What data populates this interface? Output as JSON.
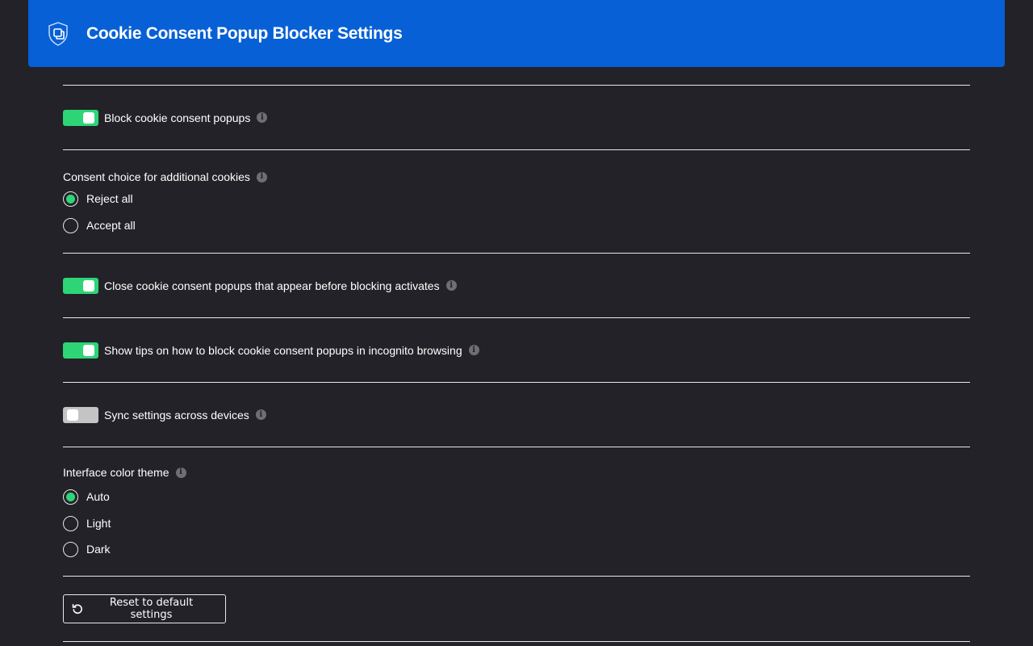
{
  "header": {
    "title": "Cookie Consent Popup Blocker Settings",
    "logo_icon": "shield-copy-icon",
    "background_color": "#0760d6"
  },
  "settings": {
    "block_popups": {
      "label": "Block cookie consent popups",
      "enabled": true,
      "info_icon": "info-icon"
    },
    "consent_choice": {
      "title": "Consent choice for additional cookies",
      "info_icon": "info-icon",
      "options": [
        {
          "label": "Reject all",
          "selected": true
        },
        {
          "label": "Accept all",
          "selected": false
        }
      ]
    },
    "close_early_popups": {
      "label": "Close cookie consent popups that appear before blocking activates",
      "enabled": true,
      "info_icon": "info-icon"
    },
    "incognito_tips": {
      "label": "Show tips on how to block cookie consent popups in incognito browsing",
      "enabled": true,
      "info_icon": "info-icon"
    },
    "sync_settings": {
      "label": "Sync settings across devices",
      "enabled": false,
      "info_icon": "info-icon"
    },
    "color_theme": {
      "title": "Interface color theme",
      "info_icon": "info-icon",
      "options": [
        {
          "label": "Auto",
          "selected": true
        },
        {
          "label": "Light",
          "selected": false
        },
        {
          "label": "Dark",
          "selected": false
        }
      ]
    }
  },
  "reset": {
    "label": "Reset to default settings",
    "icon": "reset-icon"
  },
  "colors": {
    "accent": "#2dd576",
    "toggle_off": "#c4c4c4",
    "background": "#232228"
  }
}
